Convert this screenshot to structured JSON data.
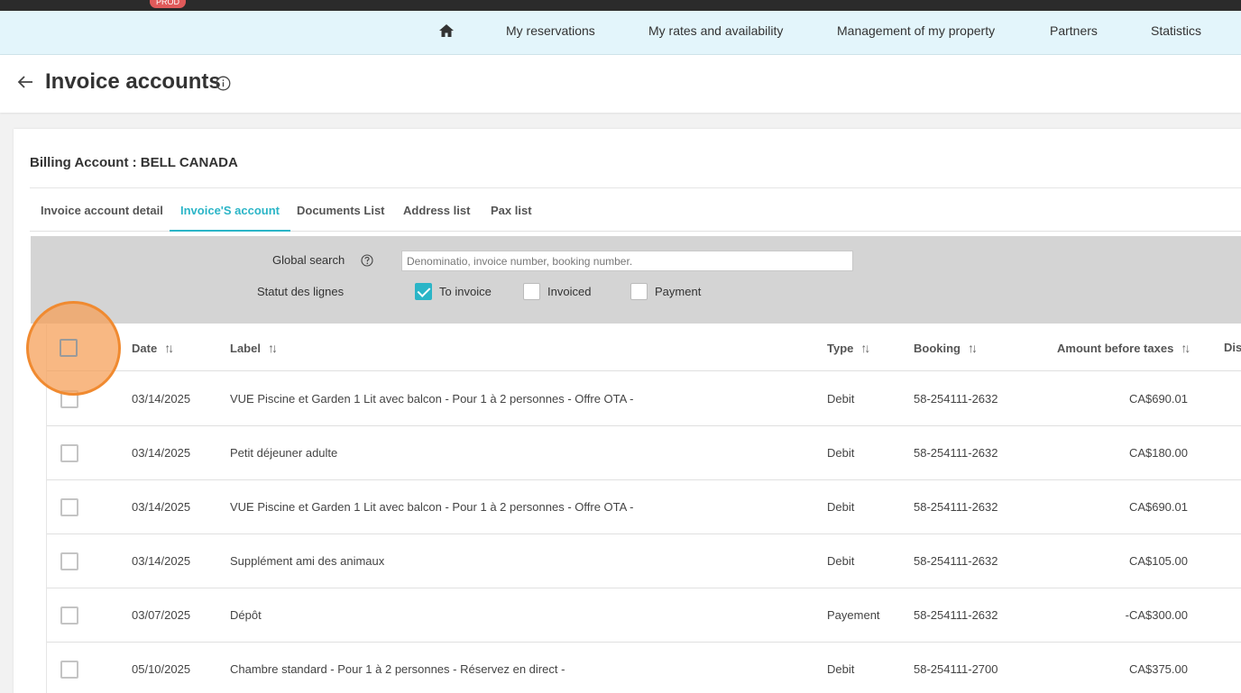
{
  "env_badge": "PROD",
  "nav": {
    "home_icon": "home-icon",
    "items": [
      "My reservations",
      "My rates and availability",
      "Management of my property",
      "Partners",
      "Statistics"
    ]
  },
  "header": {
    "title": "Invoice accounts",
    "back_icon": "arrow-left-icon",
    "info_icon": "info-icon"
  },
  "billing": {
    "title": "Billing Account : BELL CANADA"
  },
  "tabs": [
    {
      "label": "Invoice account detail",
      "active": false
    },
    {
      "label": "Invoice'S account",
      "active": true
    },
    {
      "label": "Documents List",
      "active": false
    },
    {
      "label": "Address list",
      "active": false
    },
    {
      "label": "Pax list",
      "active": false
    }
  ],
  "filters": {
    "global_search_label": "Global search",
    "search_placeholder": "Denominatio, invoice number, booking number.",
    "search_value": "",
    "status_label": "Statut des lignes",
    "status_options": [
      {
        "label": "To invoice",
        "checked": true
      },
      {
        "label": "Invoiced",
        "checked": false
      },
      {
        "label": "Payment",
        "checked": false
      }
    ]
  },
  "table": {
    "columns": [
      "Date",
      "Label",
      "Type",
      "Booking",
      "Amount before taxes",
      "Dis"
    ],
    "rows": [
      {
        "date": "03/14/2025",
        "label": "VUE Piscine et Garden 1 Lit avec balcon - Pour 1 à 2 personnes - Offre OTA -",
        "type": "Debit",
        "booking": "58-254111-2632",
        "amount": "CA$690.01"
      },
      {
        "date": "03/14/2025",
        "label": "Petit déjeuner adulte",
        "type": "Debit",
        "booking": "58-254111-2632",
        "amount": "CA$180.00"
      },
      {
        "date": "03/14/2025",
        "label": "VUE Piscine et Garden 1 Lit avec balcon - Pour 1 à 2 personnes - Offre OTA -",
        "type": "Debit",
        "booking": "58-254111-2632",
        "amount": "CA$690.01"
      },
      {
        "date": "03/14/2025",
        "label": "Supplément ami des animaux",
        "type": "Debit",
        "booking": "58-254111-2632",
        "amount": "CA$105.00"
      },
      {
        "date": "03/07/2025",
        "label": "Dépôt",
        "type": "Payement",
        "booking": "58-254111-2632",
        "amount": "-CA$300.00"
      },
      {
        "date": "05/10/2025",
        "label": "Chambre standard - Pour 1 à 2 personnes - Réservez en direct -",
        "type": "Debit",
        "booking": "58-254111-2700",
        "amount": "CA$375.00"
      }
    ]
  },
  "colors": {
    "accent": "#2bb5c7",
    "nav_bg": "#e3f5fb",
    "highlight": "#f08a30",
    "badge": "#e05a5a"
  }
}
